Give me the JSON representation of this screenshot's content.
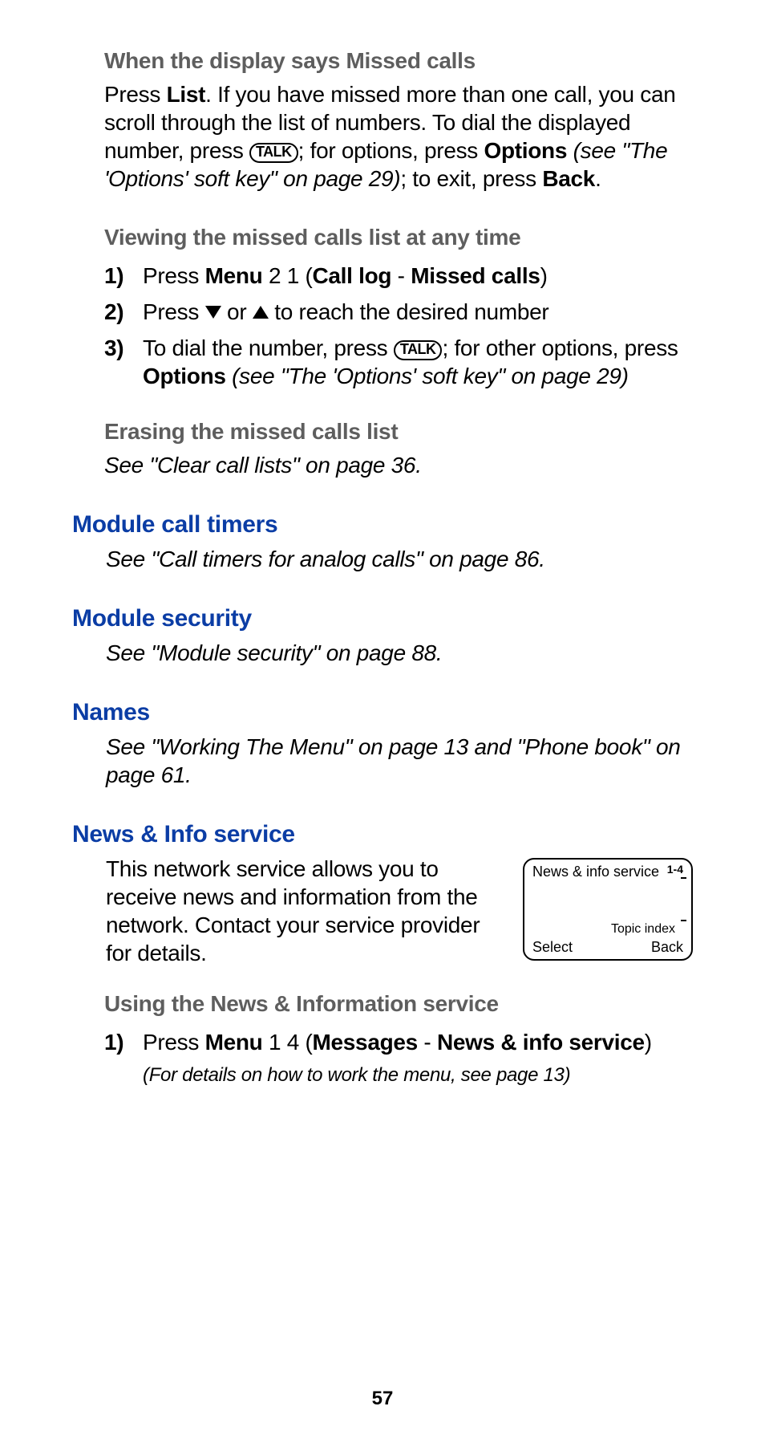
{
  "section1": {
    "heading_prefix": "When the display says ",
    "heading_emph": "Missed calls",
    "p1_seg1": "Press ",
    "p1_seg2_bold": "List",
    "p1_seg3": ". If you have missed more than one call, you can scroll through the list of numbers. To dial the displayed number, press ",
    "p1_talk": "TALK",
    "p1_seg4": "; for options, press ",
    "p1_seg5_bold": "Options",
    "p1_seg6_italic": " (see \"The 'Options' soft key\" on page 29)",
    "p1_seg7": "; to exit, press ",
    "p1_seg8_bold": "Back",
    "p1_seg9": "."
  },
  "section2": {
    "heading": "Viewing the missed calls list at any time",
    "steps": {
      "m1": "1)",
      "s1a": "Press ",
      "s1b_bold": "Menu",
      "s1c": " 2 1 (",
      "s1d_bold": "Call log",
      "s1e": " - ",
      "s1f_bold": "Missed calls",
      "s1g": ")",
      "m2": "2)",
      "s2a": "Press ",
      "s2b": " or ",
      "s2c": " to reach the desired number",
      "m3": "3)",
      "s3a": "To dial the number, press ",
      "s3_talk": "TALK",
      "s3b": "; for other options, press ",
      "s3c_bold": "Options",
      "s3d_italic": " (see \"The 'Options' soft key\" on page 29)"
    }
  },
  "section3": {
    "heading": "Erasing the missed calls list",
    "ref": "See \"Clear call lists\" on page 36."
  },
  "section4": {
    "heading": "Module call timers",
    "ref": "See \"Call timers for analog calls\" on page 86."
  },
  "section5": {
    "heading": "Module security",
    "ref": "See \"Module security\" on page 88."
  },
  "section6": {
    "heading": "Names",
    "ref": "See \"Working The Menu\" on page 13 and \"Phone book\" on page 61."
  },
  "section7": {
    "heading": "News & Info service",
    "intro": "This network service allows you to receive news and information from the network. Contact your service provider for details.",
    "screen": {
      "title": "News & info service",
      "idx": "1-4",
      "topic": "Topic index",
      "select": "Select",
      "back": "Back"
    },
    "sub_heading": "Using the News & Information service",
    "steps": {
      "m1": "1)",
      "s1a": "Press ",
      "s1b_bold": "Menu",
      "s1c": " 1 4 (",
      "s1d_bold": "Messages",
      "s1e": " - ",
      "s1f_bold": "News & info service",
      "s1g": ")",
      "note": "(For details on how to work the menu, see page 13)"
    }
  },
  "page_number": "57"
}
